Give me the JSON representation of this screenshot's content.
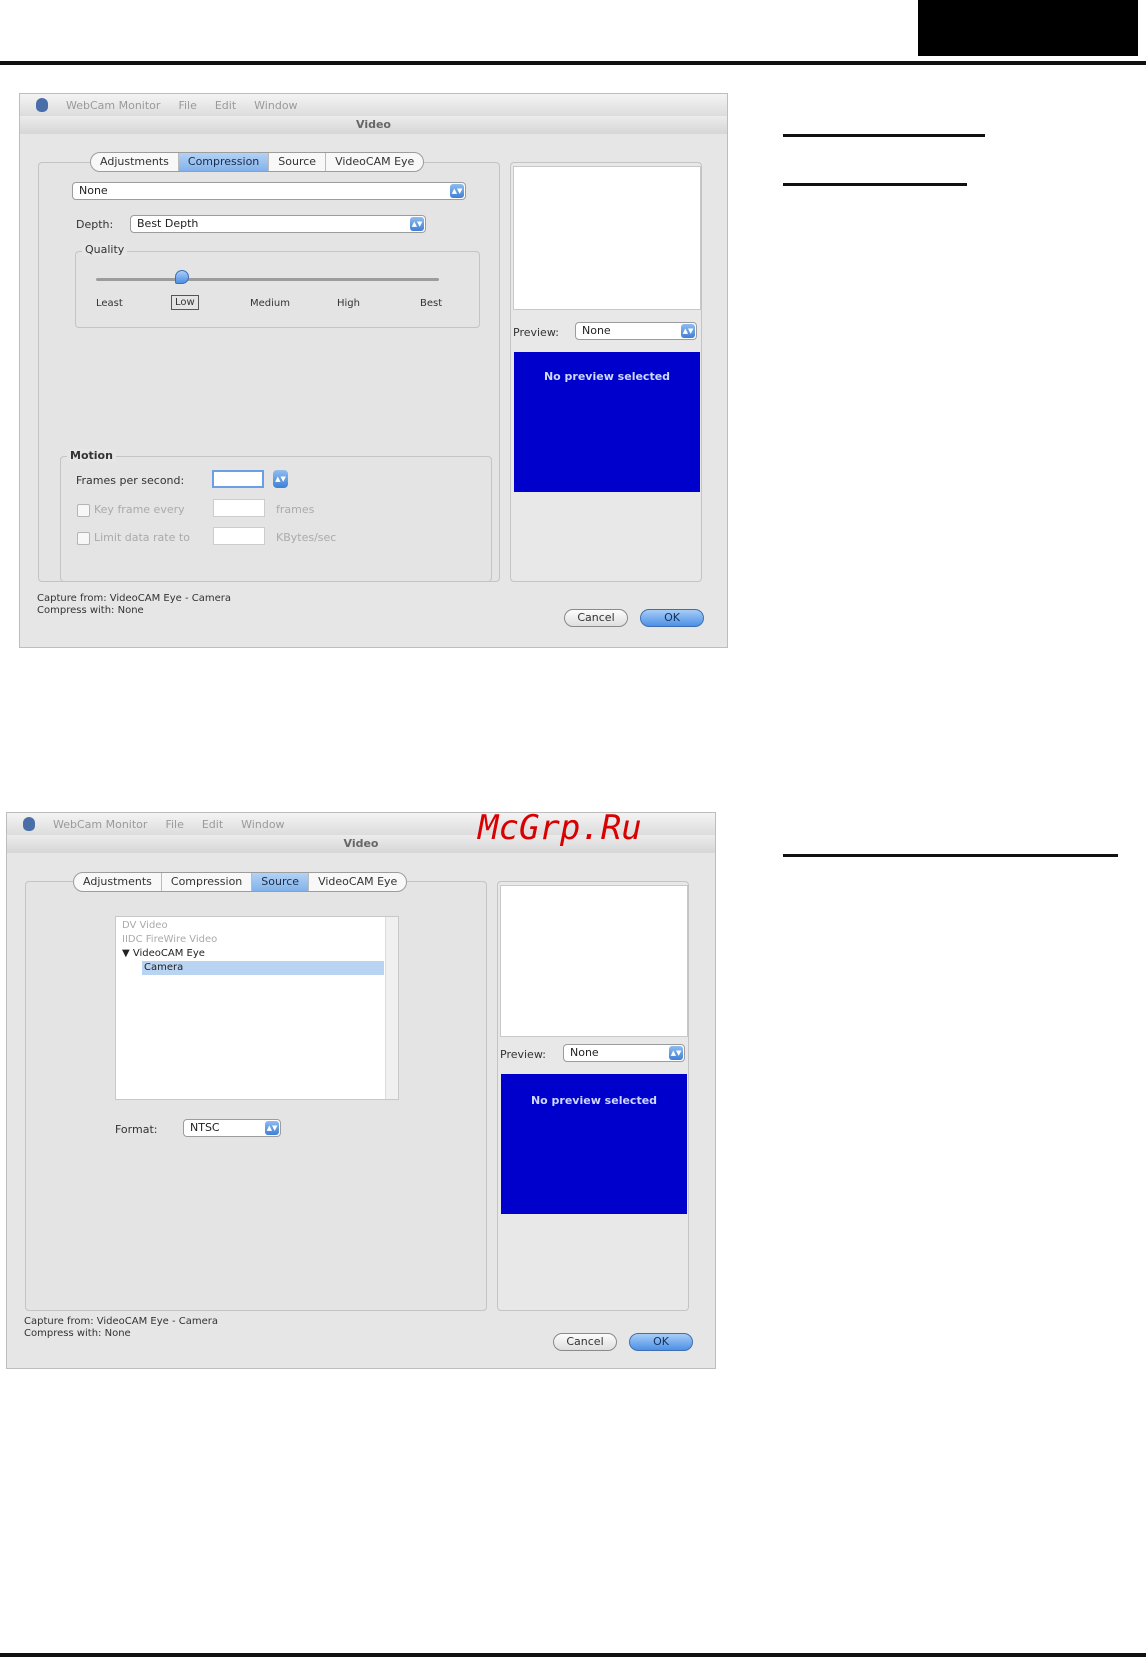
{
  "watermark": "McGrp.Ru",
  "dialog1": {
    "menu": {
      "app": "WebCam Monitor",
      "file": "File",
      "edit": "Edit",
      "window": "Window"
    },
    "title": "Video",
    "tabs": [
      {
        "label": "Adjustments",
        "selected": false
      },
      {
        "label": "Compression",
        "selected": true
      },
      {
        "label": "Source",
        "selected": false
      },
      {
        "label": "VideoCAM Eye",
        "selected": false
      }
    ],
    "compressor": "None",
    "depth": {
      "label": "Depth:",
      "value": "Best Depth"
    },
    "quality": {
      "label": "Quality",
      "ticks": [
        "Least",
        "Low",
        "Medium",
        "High",
        "Best"
      ],
      "level_fraction": 0.25
    },
    "motion": {
      "label": "Motion",
      "fps_label": "Frames per second:",
      "fps_value": "",
      "key_frame_label": "Key frame every",
      "key_frame_unit": "frames",
      "limit_label": "Limit data rate to",
      "limit_unit": "KBytes/sec"
    },
    "preview": {
      "label": "Preview:",
      "value": "None",
      "message": "No preview selected"
    },
    "status": {
      "line1": "Capture from: VideoCAM Eye - Camera",
      "line2": "Compress with: None"
    },
    "buttons": {
      "cancel": "Cancel",
      "ok": "OK"
    }
  },
  "dialog2": {
    "menu": {
      "app": "WebCam Monitor",
      "file": "File",
      "edit": "Edit",
      "window": "Window"
    },
    "title": "Video",
    "tabs": [
      {
        "label": "Adjustments",
        "selected": false
      },
      {
        "label": "Compression",
        "selected": false
      },
      {
        "label": "Source",
        "selected": true
      },
      {
        "label": "VideoCAM Eye",
        "selected": false
      }
    ],
    "sources": [
      {
        "label": "DV Video",
        "dim": true,
        "indent": 0
      },
      {
        "label": "IIDC FireWire Video",
        "dim": true,
        "indent": 0
      },
      {
        "label": "▼ VideoCAM Eye",
        "dim": false,
        "indent": 0
      },
      {
        "label": "Camera",
        "dim": false,
        "indent": 1,
        "selected": true
      }
    ],
    "format": {
      "label": "Format:",
      "value": "NTSC"
    },
    "preview": {
      "label": "Preview:",
      "value": "None",
      "message": "No preview selected"
    },
    "status": {
      "line1": "Capture from: VideoCAM Eye - Camera",
      "line2": "Compress with: None"
    },
    "buttons": {
      "cancel": "Cancel",
      "ok": "OK"
    }
  }
}
